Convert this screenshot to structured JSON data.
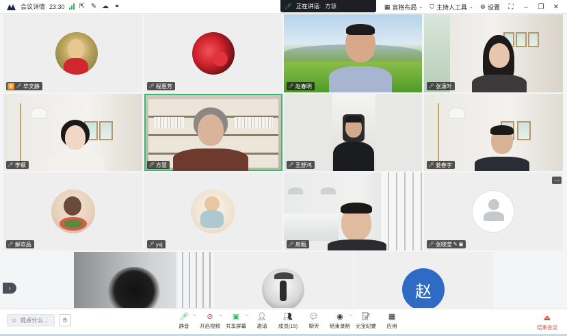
{
  "topbar": {
    "meeting_info": "会议详情",
    "timer": "23:30",
    "speaking_label": "正在讲话:",
    "speaking_name": "方慧",
    "layout_label": "宫格布局",
    "host_tools_label": "主持人工具",
    "settings_label": "设置"
  },
  "participants": [
    {
      "name": "毕文静",
      "host": true
    },
    {
      "name": "程惠芳"
    },
    {
      "name": "赵春明"
    },
    {
      "name": "张潇叶"
    },
    {
      "name": "李颖"
    },
    {
      "name": "方慧",
      "active": true
    },
    {
      "name": "王舒鸿"
    },
    {
      "name": "姜春宇"
    },
    {
      "name": "解欢品"
    },
    {
      "name": "yxj"
    },
    {
      "name": "房甄"
    },
    {
      "name": "张晓莹"
    }
  ],
  "bottom_avatar_letter": "赵",
  "chat": {
    "placeholder": "说点什么..."
  },
  "toolbar": {
    "mute": "静音",
    "video": "开启视频",
    "share": "共享屏幕",
    "invite": "邀请",
    "members": "成员(15)",
    "chat": "聊天",
    "record": "结束录制",
    "minutes": "元宝纪要",
    "apps": "应用",
    "end": "结束会议"
  },
  "colors": {
    "accent": "#2fbf6f",
    "end": "#e04a3a",
    "avatar_blue": "#2f6bc4"
  }
}
